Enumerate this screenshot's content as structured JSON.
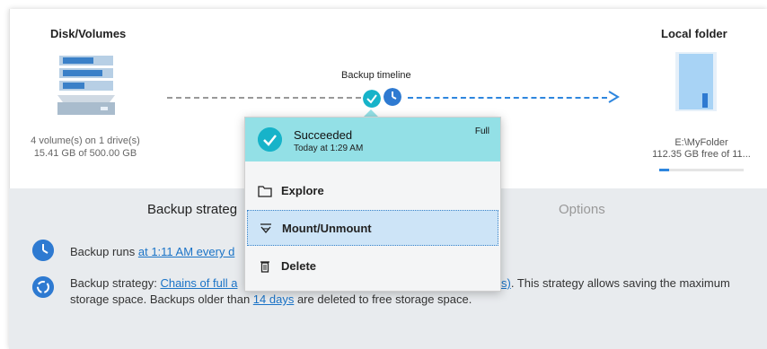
{
  "source": {
    "title": "Disk/Volumes",
    "summary": "4 volume(s) on 1 drive(s) 15.41 GB of 500.00 GB",
    "icon": "disk-stack-icon"
  },
  "timeline": {
    "label": "Backup timeline",
    "points": [
      {
        "icon": "check-icon",
        "status": "succeeded"
      },
      {
        "icon": "clock-icon",
        "status": "scheduled"
      }
    ]
  },
  "destination": {
    "title": "Local folder",
    "path": "E:\\MyFolder",
    "free_space": "112.35 GB free of 11...",
    "icon": "folder-icon"
  },
  "tabs": [
    {
      "label": "Backup strateg",
      "active": true
    },
    {
      "label": "Options",
      "active": false
    }
  ],
  "info": {
    "schedule_prefix": "Backup runs ",
    "schedule_link": "at 1:11 AM every d",
    "strategy_prefix": "Backup strategy: ",
    "strategy_link": "Chains of full a",
    "strategy_link_tail": "s)",
    "strategy_suffix": ". This strategy allows saving the maximum",
    "strategy_line2_prefix": "storage space. Backups older than ",
    "retention_link": "14 days",
    "strategy_line2_suffix": " are deleted to free storage space."
  },
  "popup": {
    "status": "Succeeded",
    "time": "Today at 1:29 AM",
    "type": "Full",
    "menu": [
      {
        "label": "Explore",
        "icon": "folder-outline-icon",
        "selected": false
      },
      {
        "label": "Mount/Unmount",
        "icon": "mount-icon",
        "selected": true
      },
      {
        "label": "Delete",
        "icon": "trash-icon",
        "selected": false
      }
    ]
  },
  "colors": {
    "accent": "#2e86de",
    "popup_header": "#93e0e6",
    "success": "#17b3c9",
    "panel": "#e8ebee"
  }
}
